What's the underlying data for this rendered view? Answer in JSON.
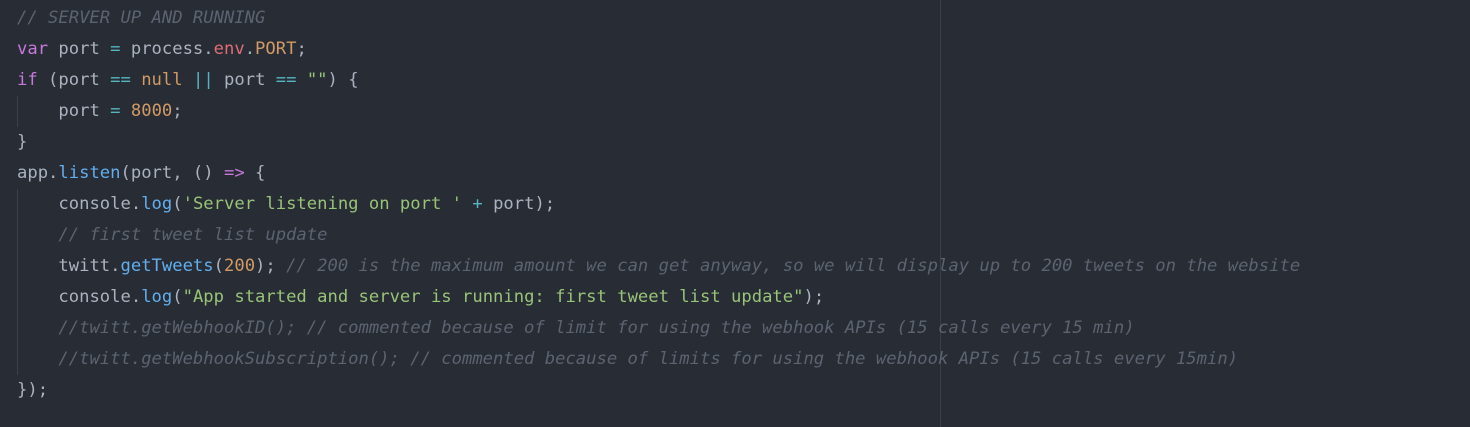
{
  "colors": {
    "background": "#282c34",
    "comment": "#5c6370",
    "keyword": "#c678dd",
    "function": "#61afef",
    "property": "#e06c75",
    "number": "#d19a66",
    "string": "#98c379",
    "operator": "#56b6c2",
    "plain": "#abb2bf"
  },
  "lines": [
    [
      {
        "t": "// SERVER UP AND RUNNING",
        "c": "cmt"
      }
    ],
    [
      {
        "t": "var",
        "c": "kw"
      },
      {
        "t": " port ",
        "c": "pl"
      },
      {
        "t": "=",
        "c": "op"
      },
      {
        "t": " process.",
        "c": "pl"
      },
      {
        "t": "env",
        "c": "prop"
      },
      {
        "t": ".",
        "c": "pl"
      },
      {
        "t": "PORT",
        "c": "lit"
      },
      {
        "t": ";",
        "c": "pl"
      }
    ],
    [
      {
        "t": "if",
        "c": "kw"
      },
      {
        "t": " (port ",
        "c": "pl"
      },
      {
        "t": "==",
        "c": "op"
      },
      {
        "t": " ",
        "c": "pl"
      },
      {
        "t": "null",
        "c": "lit"
      },
      {
        "t": " ",
        "c": "pl"
      },
      {
        "t": "||",
        "c": "op"
      },
      {
        "t": " port ",
        "c": "pl"
      },
      {
        "t": "==",
        "c": "op"
      },
      {
        "t": " ",
        "c": "pl"
      },
      {
        "t": "\"\"",
        "c": "str"
      },
      {
        "t": ") {",
        "c": "pl"
      }
    ],
    [
      {
        "t": "    ",
        "c": "guide"
      },
      {
        "t": "port ",
        "c": "pl"
      },
      {
        "t": "=",
        "c": "op"
      },
      {
        "t": " ",
        "c": "pl"
      },
      {
        "t": "8000",
        "c": "num"
      },
      {
        "t": ";",
        "c": "pl"
      }
    ],
    [
      {
        "t": "}",
        "c": "pl"
      }
    ],
    [
      {
        "t": "app.",
        "c": "pl"
      },
      {
        "t": "listen",
        "c": "fn"
      },
      {
        "t": "(port, () ",
        "c": "pl"
      },
      {
        "t": "=>",
        "c": "kw"
      },
      {
        "t": " {",
        "c": "pl"
      }
    ],
    [
      {
        "t": "    ",
        "c": "guide"
      },
      {
        "t": "console.",
        "c": "pl"
      },
      {
        "t": "log",
        "c": "fn"
      },
      {
        "t": "(",
        "c": "pl"
      },
      {
        "t": "'Server listening on port '",
        "c": "str"
      },
      {
        "t": " ",
        "c": "pl"
      },
      {
        "t": "+",
        "c": "op"
      },
      {
        "t": " port);",
        "c": "pl"
      }
    ],
    [
      {
        "t": "    ",
        "c": "guide"
      },
      {
        "t": "// first tweet list update",
        "c": "cmt"
      }
    ],
    [
      {
        "t": "    ",
        "c": "guide"
      },
      {
        "t": "twitt.",
        "c": "pl"
      },
      {
        "t": "getTweets",
        "c": "fn"
      },
      {
        "t": "(",
        "c": "pl"
      },
      {
        "t": "200",
        "c": "num"
      },
      {
        "t": "); ",
        "c": "pl"
      },
      {
        "t": "// 200 is the maximum amount we can get anyway, so we will display up to 200 tweets on the website",
        "c": "cmt"
      }
    ],
    [
      {
        "t": "    ",
        "c": "guide"
      },
      {
        "t": "console.",
        "c": "pl"
      },
      {
        "t": "log",
        "c": "fn"
      },
      {
        "t": "(",
        "c": "pl"
      },
      {
        "t": "\"App started and server is running: first tweet list update\"",
        "c": "str"
      },
      {
        "t": ");",
        "c": "pl"
      }
    ],
    [
      {
        "t": "    ",
        "c": "guide"
      },
      {
        "t": "//twitt.getWebhookID(); // commented because of limit for using the webhook APIs (15 calls every 15 min)",
        "c": "cmt"
      }
    ],
    [
      {
        "t": "    ",
        "c": "guide"
      },
      {
        "t": "//twitt.getWebhookSubscription(); // commented because of limits for using the webhook APIs (15 calls every 15min)",
        "c": "cmt"
      }
    ],
    [
      {
        "t": "});",
        "c": "pl"
      }
    ]
  ]
}
